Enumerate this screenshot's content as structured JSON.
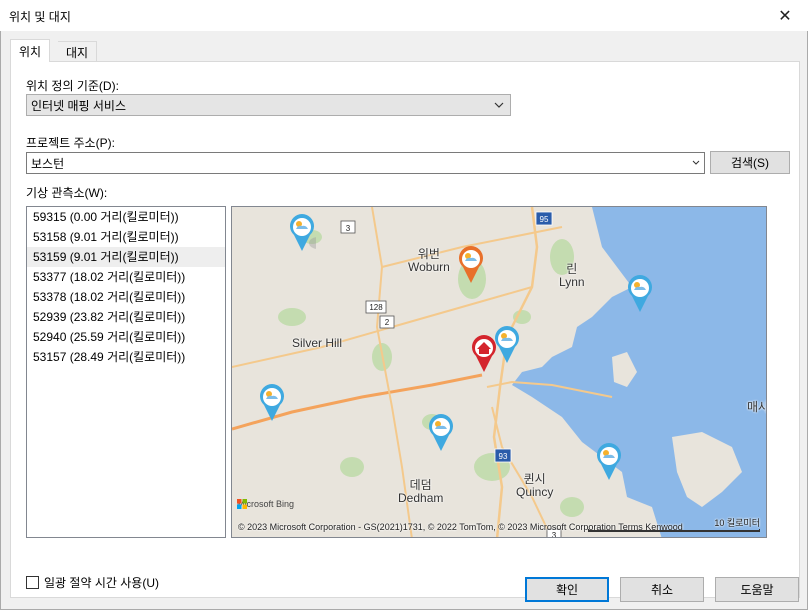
{
  "window": {
    "title": "위치 및 대지"
  },
  "tabs": [
    {
      "label": "위치",
      "active": true
    },
    {
      "label": "대지",
      "active": false
    }
  ],
  "location_basis": {
    "label": "위치 정의 기준(D):",
    "selected": "인터넷 매핑 서비스"
  },
  "project_address": {
    "label": "프로젝트 주소(P):",
    "value": "보스턴",
    "search_label": "검색(S)"
  },
  "weather_stations": {
    "label": "기상 관측소(W):",
    "items": [
      "59315 (0.00 거리(킬로미터))",
      "53158 (9.01 거리(킬로미터))",
      "53159 (9.01 거리(킬로미터))",
      "53377 (18.02 거리(킬로미터))",
      "53378 (18.02 거리(킬로미터))",
      "52939 (23.82 거리(킬로미터))",
      "52940 (25.59 거리(킬로미터))",
      "53157 (28.49 거리(킬로미터))"
    ],
    "selected_index": 2
  },
  "map": {
    "places": {
      "woburn_ko": "워번",
      "woburn": "Woburn",
      "lynn_ko": "린",
      "lynn": "Lynn",
      "silver_hill": "Silver Hill",
      "mass_ko": "매사추세",
      "dedham_ko": "데덤",
      "dedham": "Dedham",
      "quincy_ko": "퀸시",
      "quincy": "Quincy"
    },
    "routes": {
      "r3": "3",
      "r95": "95",
      "r128": "128",
      "r2": "2",
      "r93": "93",
      "r3b": "3"
    },
    "copyright": "© 2023 Microsoft Corporation - GS(2021)1731, © 2022 TomTom, © 2023 Microsoft Corporation   Terms   Kenwood",
    "bing_label": "Microsoft Bing",
    "scale_label": "10 킬로미터",
    "colors": {
      "water": "#8cb8e8",
      "land": "#e8e4dc",
      "park": "#c4dcb0",
      "highway": "#f4a35c",
      "pin_blue": "#3fa9e0",
      "pin_orange": "#e8702a",
      "pin_red": "#d4252d"
    }
  },
  "daylight_saving": {
    "label": "일광 절약 시간 사용(U)",
    "checked": false
  },
  "buttons": {
    "ok": "확인",
    "cancel": "취소",
    "help": "도움말"
  }
}
